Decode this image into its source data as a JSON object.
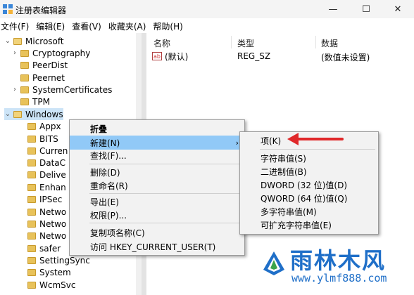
{
  "window": {
    "title": "注册表编辑器",
    "minimize": "—",
    "maximize": "☐",
    "close": "✕"
  },
  "menubar": [
    "文件(F)",
    "编辑(E)",
    "查看(V)",
    "收藏夹(A)",
    "帮助(H)"
  ],
  "tree": [
    {
      "label": "Microsoft",
      "expander": "⌄"
    },
    {
      "label": "Cryptography",
      "expander": "›"
    },
    {
      "label": "PeerDist",
      "expander": ""
    },
    {
      "label": "Peernet",
      "expander": ""
    },
    {
      "label": "SystemCertificates",
      "expander": "›"
    },
    {
      "label": "TPM",
      "expander": ""
    },
    {
      "label": "Windows",
      "expander": "⌄"
    },
    {
      "label": "Appx",
      "expander": ""
    },
    {
      "label": "BITS",
      "expander": ""
    },
    {
      "label": "Curren",
      "expander": ""
    },
    {
      "label": "DataC",
      "expander": ""
    },
    {
      "label": "Delive",
      "expander": ""
    },
    {
      "label": "Enhan",
      "expander": ""
    },
    {
      "label": "IPSec",
      "expander": ""
    },
    {
      "label": "Netwo",
      "expander": ""
    },
    {
      "label": "Netwo",
      "expander": ""
    },
    {
      "label": "Netwo",
      "expander": ""
    },
    {
      "label": "safer",
      "expander": ""
    },
    {
      "label": "SettingSync",
      "expander": ""
    },
    {
      "label": "System",
      "expander": ""
    },
    {
      "label": "WcmSvc",
      "expander": ""
    }
  ],
  "columns": {
    "name": "名称",
    "type": "类型",
    "data": "数据"
  },
  "value_row": {
    "icon": "ab",
    "name": "(默认)",
    "type": "REG_SZ",
    "data": "(数值未设置)"
  },
  "context_menu": {
    "collapse": "折叠",
    "new": "新建(N)",
    "submenu_arrow": "›",
    "find": "查找(F)...",
    "delete": "删除(D)",
    "rename": "重命名(R)",
    "export": "导出(E)",
    "permissions": "权限(P)...",
    "copy_name": "复制项名称(C)",
    "visit": "访问 HKEY_CURRENT_USER(T)"
  },
  "submenu": [
    "项(K)",
    "字符串值(S)",
    "二进制值(B)",
    "DWORD (32 位)值(D)",
    "QWORD (64 位)值(Q)",
    "多字符串值(M)",
    "可扩充字符串值(E)"
  ],
  "watermark": {
    "title": "雨林木风",
    "url": "www.ylmf888.com"
  },
  "colors": {
    "highlight": "#91c9f7",
    "arrow": "#e0282a",
    "watermark": "#1f6fc8"
  }
}
